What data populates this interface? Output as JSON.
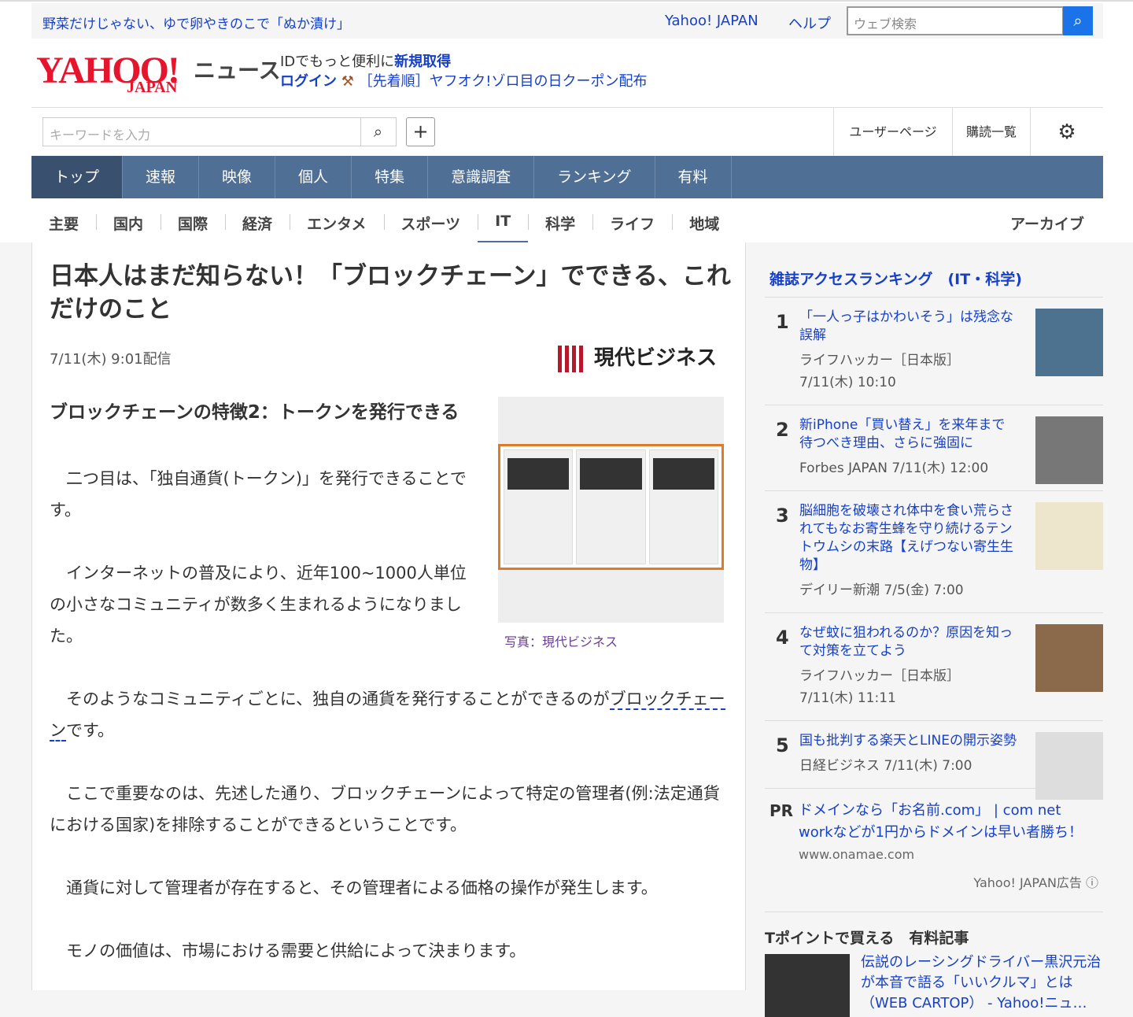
{
  "promo": {
    "headline": "野菜だけじゃない、ゆで卵やきのこで「ぬか漬け」",
    "yahoo_japan": "Yahoo! JAPAN",
    "help": "ヘルプ",
    "web_search_placeholder": "ウェブ検索"
  },
  "header": {
    "logo": "YAHOO! JAPAN",
    "service": "ニュース",
    "id_text": "IDでもっと便利に",
    "signup": "新規取得",
    "login": "ログイン",
    "auction_promo": "［先着順］ヤフオク!ゾロ目の日クーポン配布"
  },
  "toolbar": {
    "keyword_placeholder": "キーワードを入力",
    "user_page": "ユーザーページ",
    "subscriptions": "購読一覧"
  },
  "global_nav": [
    "トップ",
    "速報",
    "映像",
    "個人",
    "特集",
    "意識調査",
    "ランキング",
    "有料"
  ],
  "sub_nav": [
    "主要",
    "国内",
    "国際",
    "経済",
    "エンタメ",
    "スポーツ",
    "IT",
    "科学",
    "ライフ",
    "地域"
  ],
  "archive": "アーカイブ",
  "article": {
    "title": "日本人はまだ知らない！「ブロックチェーン」でできる、これだけのこと",
    "date": "7/11(木) 9:01配信",
    "publisher": "現代ビジネス",
    "subheading": "ブロックチェーンの特徴2：トークンを発行できる",
    "photo_caption": "写真：現代ビジネス",
    "p1": "　二つ目は、「独自通貨(トークン)」を発行できることです。",
    "p2": "　インターネットの普及により、近年100~1000人単位の小さなコミュニティが数多く生まれるようになりました。",
    "p3a": "　そのようなコミュニティごとに、独自の通貨を発行することができるのが",
    "p3link": "ブロックチェーン",
    "p3b": "です。",
    "p4": "　ここで重要なのは、先述した通り、ブロックチェーンによって特定の管理者(例:法定通貨における国家)を排除することができるということです。",
    "p5": "　通貨に対して管理者が存在すると、その管理者による価格の操作が発生します。",
    "p6": "　モノの価値は、市場における需要と供給によって決まります。"
  },
  "sidebar": {
    "ranking_title": "雑誌アクセスランキング　(IT・科学)",
    "ranking": [
      {
        "n": "1",
        "title": "「一人っ子はかわいそう」は残念な誤解",
        "meta": "ライフハッカー［日本版］ 7/11(木) 10:10"
      },
      {
        "n": "2",
        "title": "新iPhone「買い替え」を来年まで待つべき理由、さらに強固に",
        "meta": "Forbes JAPAN 7/11(木) 12:00"
      },
      {
        "n": "3",
        "title": "脳細胞を破壊され体中を食い荒らされてもなお寄生蜂を守り続けるテントウムシの末路【えげつない寄生生物】",
        "meta": "デイリー新潮 7/5(金) 7:00"
      },
      {
        "n": "4",
        "title": "なぜ蚊に狙われるのか？原因を知って対策を立てよう",
        "meta": "ライフハッカー［日本版］ 7/11(木) 11:11"
      },
      {
        "n": "5",
        "title": "国も批判する楽天とLINEの開示姿勢",
        "meta": "日経ビジネス 7/11(木) 7:00"
      }
    ],
    "pr_label": "PR",
    "pr_title": "ドメインなら「お名前.com」 | com net workなどが1円からドメインは早い者勝ち！",
    "pr_url": "www.onamae.com",
    "ad_label": "Yahoo! JAPAN広告 ⓘ",
    "tpoint_title": "Tポイントで買える　有料記事",
    "tpoint_article": "伝説のレーシングドライバー黒沢元治が本音で語る「いいクルマ」とは（WEB CARTOP） - Yahoo!ニュ…"
  }
}
